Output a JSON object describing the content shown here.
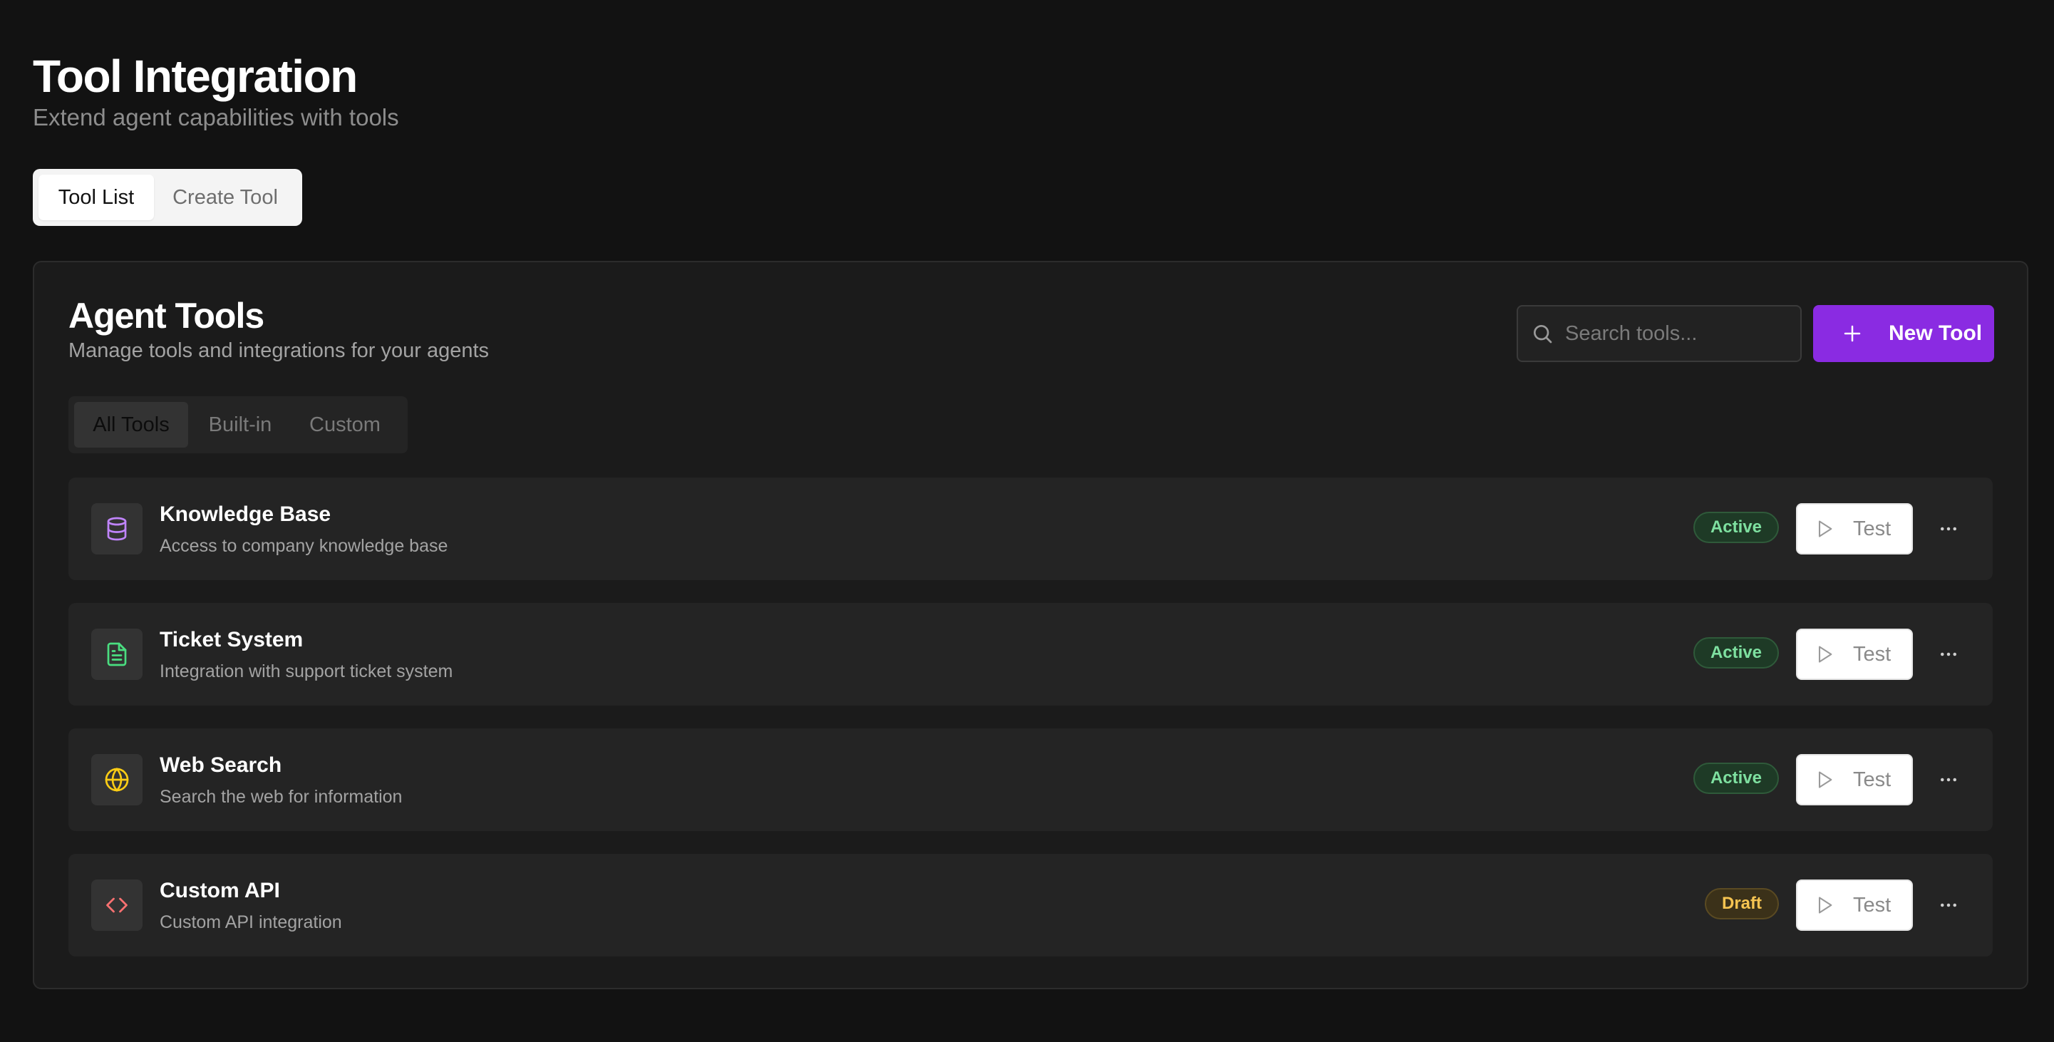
{
  "header": {
    "title": "Tool Integration",
    "subtitle": "Extend agent capabilities with tools"
  },
  "top_tabs": [
    {
      "label": "Tool List",
      "active": true
    },
    {
      "label": "Create Tool",
      "active": false
    }
  ],
  "card": {
    "title": "Agent Tools",
    "subtitle": "Manage tools and integrations for your agents",
    "search": {
      "placeholder": "Search tools...",
      "value": ""
    },
    "new_tool_label": "New Tool",
    "filter_tabs": [
      {
        "label": "All Tools",
        "active": true
      },
      {
        "label": "Built-in",
        "active": false
      },
      {
        "label": "Custom",
        "active": false
      }
    ]
  },
  "tools": [
    {
      "name": "Knowledge Base",
      "description": "Access to company knowledge base",
      "icon": "database-icon",
      "icon_color": "#c084fc",
      "status": "Active",
      "test_label": "Test"
    },
    {
      "name": "Ticket System",
      "description": "Integration with support ticket system",
      "icon": "document-icon",
      "icon_color": "#4ade80",
      "status": "Active",
      "test_label": "Test"
    },
    {
      "name": "Web Search",
      "description": "Search the web for information",
      "icon": "globe-icon",
      "icon_color": "#facc15",
      "status": "Active",
      "test_label": "Test"
    },
    {
      "name": "Custom API",
      "description": "Custom API integration",
      "icon": "code-icon",
      "icon_color": "#f87171",
      "status": "Draft",
      "test_label": "Test"
    }
  ],
  "colors": {
    "background": "#121212",
    "card": "#1b1b1b",
    "row": "#242424",
    "accent": "#8a2be2",
    "active_status": "#7ee0a0",
    "draft_status": "#f6c451"
  }
}
